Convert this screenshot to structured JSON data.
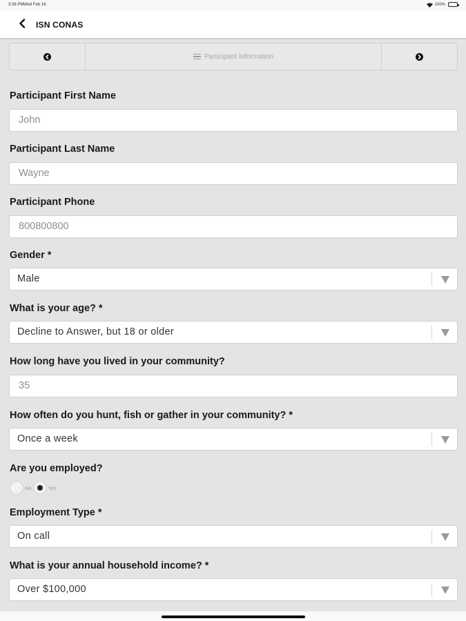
{
  "status_bar": {
    "time": "3:38 PM",
    "date": "Wed Feb 16",
    "battery": "100%",
    "battery_level": 1.0
  },
  "header": {
    "back_icon": "chevron-left-icon",
    "title": "ISN CONAS"
  },
  "pager": {
    "prev_icon": "circle-arrow-left-icon",
    "menu_icon": "hamburger-menu-icon",
    "title": "Participant Information",
    "next_icon": "circle-arrow-right-icon"
  },
  "form": {
    "first_name": {
      "label": "Participant First Name",
      "value": "John"
    },
    "last_name": {
      "label": "Participant Last Name",
      "value": "Wayne"
    },
    "phone": {
      "label": "Participant Phone",
      "value": "800800800"
    },
    "gender": {
      "label": "Gender *",
      "value": "Male"
    },
    "age": {
      "label": "What is your age? *",
      "value": "Decline to Answer, but 18 or older"
    },
    "years_in_community": {
      "label": "How long have you lived in your community?",
      "value": "35"
    },
    "hunt_frequency": {
      "label": "How often do you hunt, fish or gather in your community? *",
      "value": "Once a week"
    },
    "employed": {
      "label": "Are you employed?",
      "options": [
        "No",
        "Yes"
      ],
      "selected": "Yes"
    },
    "employment_type": {
      "label": "Employment Type *",
      "value": "On call"
    },
    "income": {
      "label": "What is your annual household income? *",
      "value": "Over $100,000"
    }
  }
}
